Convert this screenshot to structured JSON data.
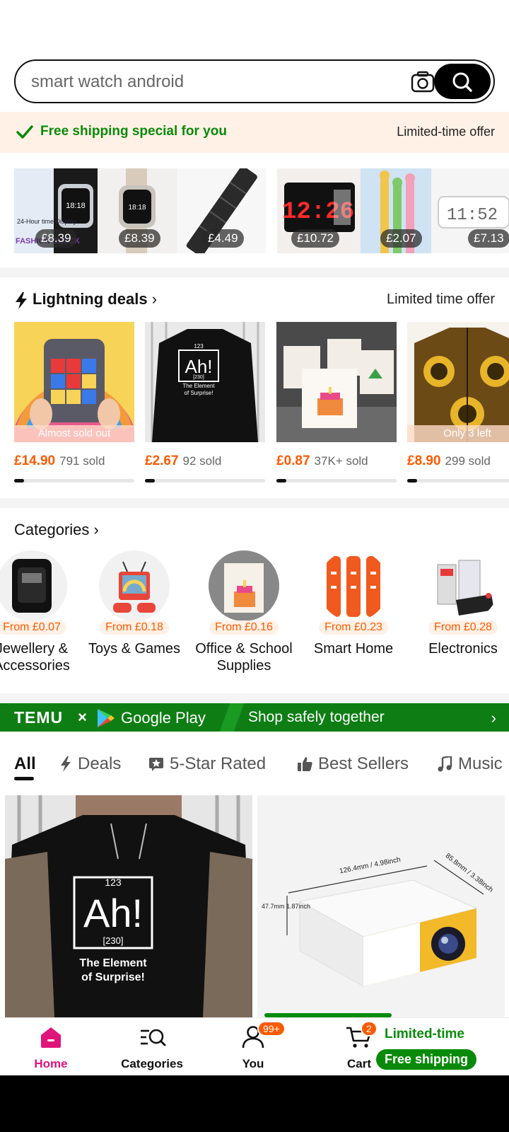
{
  "search": {
    "query": "smart watch android"
  },
  "free_shipping": {
    "label": "Free shipping special for you",
    "offer": "Limited-time offer"
  },
  "top_strip": {
    "prices": [
      "£8.39",
      "£8.39",
      "£4.49",
      "£10.72",
      "£2.07",
      "£7.13"
    ],
    "watch_caption": "24-Hour time Display",
    "watch_brand": "FASHION CLOCK"
  },
  "lightning": {
    "title": "Lightning deals",
    "subtitle": "Limited time offer",
    "items": [
      {
        "badge": "Almost sold out",
        "price": "£14.90",
        "sold": "791 sold",
        "progress": 0.08
      },
      {
        "badge": "",
        "price": "£2.67",
        "sold": "92 sold",
        "progress": 0.08
      },
      {
        "badge": "",
        "price": "£0.87",
        "sold": "37K+ sold",
        "progress": 0.08
      },
      {
        "badge": "Only 3 left",
        "price": "£8.90",
        "sold": "299 sold",
        "progress": 0.08
      }
    ]
  },
  "categories": {
    "title": "Categories",
    "items": [
      {
        "from": "From £0.07",
        "name": "Jewellery & Accessories"
      },
      {
        "from": "From £0.18",
        "name": "Toys & Games"
      },
      {
        "from": "From £0.16",
        "name": "Office & School Supplies"
      },
      {
        "from": "From £0.23",
        "name": "Smart Home"
      },
      {
        "from": "From £0.28",
        "name": "Electronics"
      }
    ]
  },
  "banner": {
    "brand": "TEMU",
    "times": "×",
    "partner": "Google Play",
    "text": "Shop safely together"
  },
  "tabs": [
    "All",
    "Deals",
    "5-Star Rated",
    "Best Sellers",
    "Music"
  ],
  "shirt_text": {
    "number": "123",
    "symbol": "Ah!",
    "mass": "[230]",
    "line1": "The Element",
    "line2": "of Surprise!"
  },
  "projector": {
    "width": "126.4mm / 4.98inch",
    "depth": "85.8mm / 3.38inch",
    "height": "47.7mm 1.87inch"
  },
  "nav": {
    "items": [
      "Home",
      "Categories",
      "You",
      "Cart"
    ],
    "you_badge": "99+",
    "cart_badge": "2",
    "limited": "Limited-time",
    "free_shipping": "Free shipping"
  },
  "colors": {
    "accent": "#fb5a00",
    "green": "#0a8a0a",
    "home": "#e0157a"
  }
}
